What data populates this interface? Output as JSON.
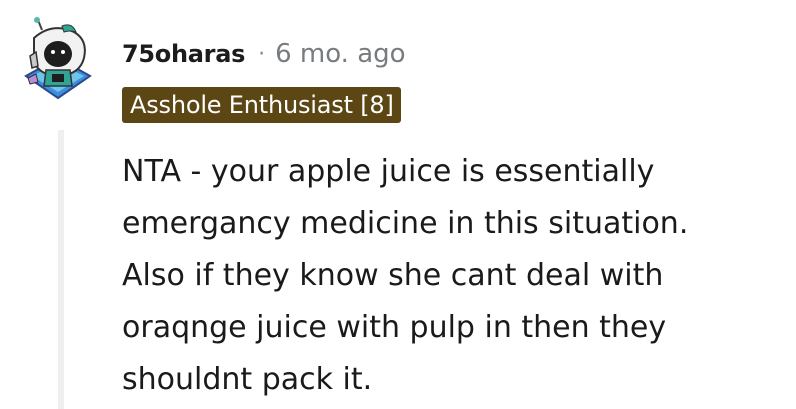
{
  "comment": {
    "author": "75oharas",
    "separator": "·",
    "timestamp": "6 mo. ago",
    "flair": "Asshole Enthusiast [8]",
    "body_lines": [
      "NTA - your apple juice is essentially",
      "emergancy medicine in this situation.",
      "Also if they know she cant deal with",
      "oraqnge juice with pulp in then they",
      "shouldnt pack it."
    ],
    "avatar_icon": "snoo-avatar-icon"
  },
  "colors": {
    "flair_background": "#5c4614",
    "flair_text": "#ffffff",
    "username": "#1c1c1c",
    "timestamp": "#787c7e",
    "thread_line": "#edeff1"
  }
}
